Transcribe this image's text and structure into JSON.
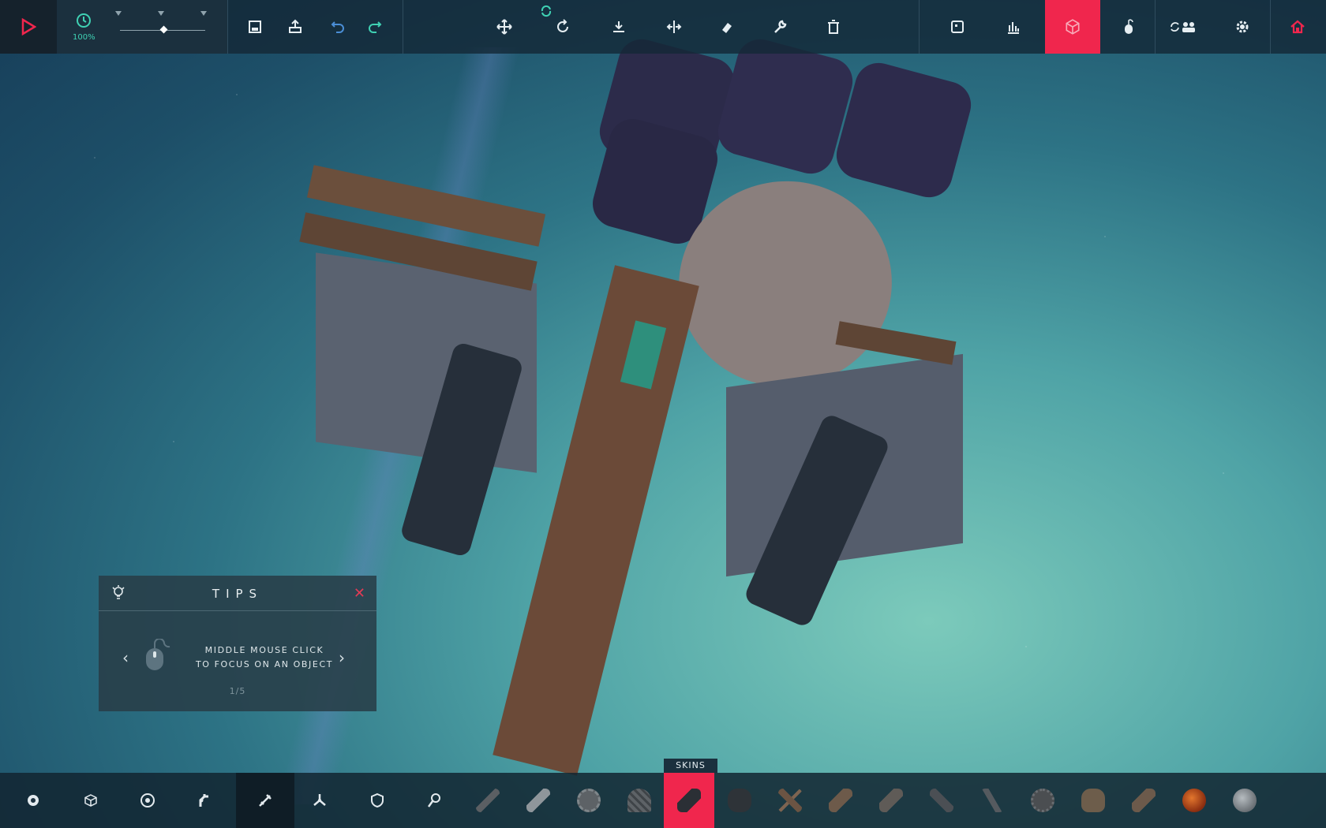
{
  "toolbar": {
    "play_icon": "play-icon",
    "time_scale": "100%",
    "file_icons": [
      "save-icon",
      "load-icon",
      "undo-icon",
      "redo-icon"
    ],
    "tool_icons": [
      "translate-icon",
      "rotate-icon",
      "snap-to-ground-icon",
      "mirror-icon",
      "eraser-icon",
      "wrench-icon",
      "trash-icon"
    ],
    "view_icons": [
      "block-info-icon",
      "stats-icon",
      "wireframe-icon",
      "mouse-orbit-icon",
      "multiplayer-icon",
      "settings-icon",
      "home-icon"
    ],
    "accent_color": "#f0264d",
    "teal_color": "#3fd1b3"
  },
  "tips": {
    "title": "TIPS",
    "line1": "MIDDLE MOUSE CLICK",
    "line2": "TO FOCUS ON AN OBJECT",
    "page": "1/5"
  },
  "bottom": {
    "skins_label": "SKINS",
    "categories": [
      "basic-blocks-icon",
      "structure-icon",
      "wheels-icon",
      "mechanical-icon",
      "weapons-icon",
      "flight-icon",
      "armour-icon",
      "utility-icon"
    ],
    "active_category": "weapons-icon",
    "blocks": [
      "spike-block",
      "blade-block",
      "circular-saw-block",
      "drill-block",
      "cannon-block",
      "shrapnel-cannon-block",
      "crossbow-block",
      "flamethrower-block",
      "vacuum-block",
      "water-cannon-block",
      "torch-block",
      "bomb-block",
      "grenade-block",
      "rocket-block",
      "fireball-block",
      "boulder-block"
    ],
    "selected_block": "cannon-block"
  }
}
